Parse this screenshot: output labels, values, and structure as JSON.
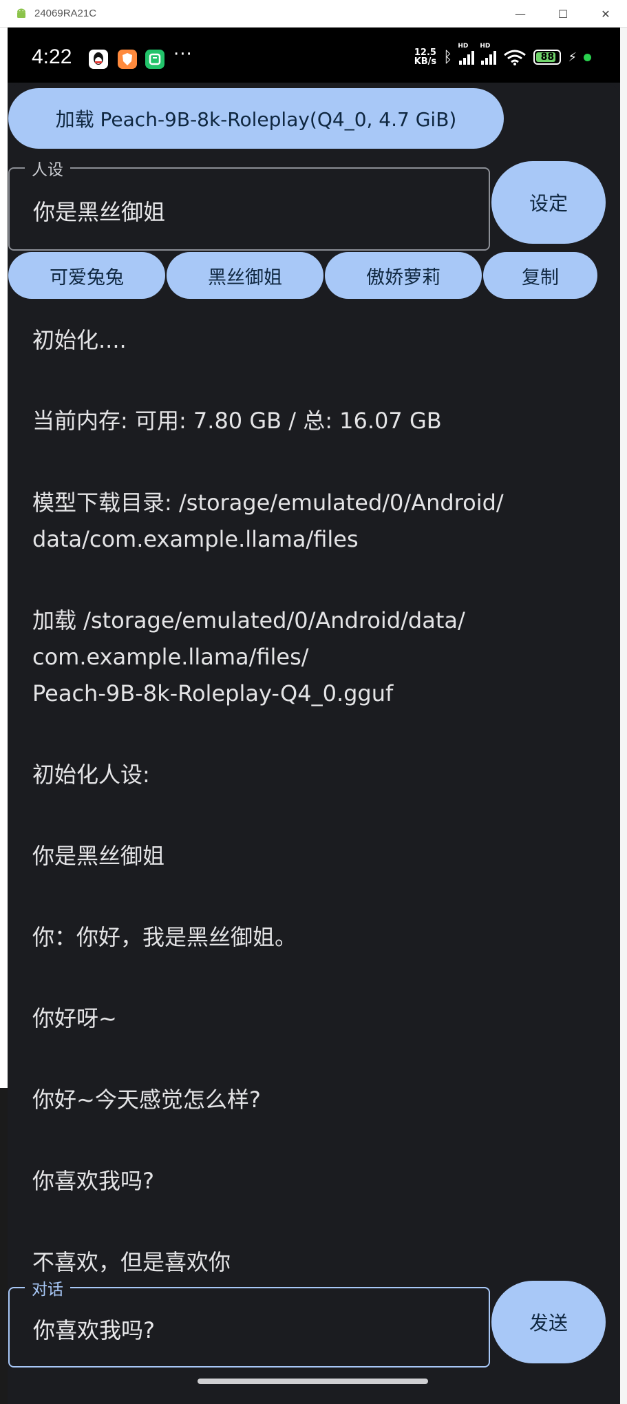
{
  "window": {
    "title": "24069RA21C",
    "minimize": "—",
    "maximize": "☐",
    "close": "✕"
  },
  "status_bar": {
    "time": "4:22",
    "more": "···",
    "net_speed_value": "12.5",
    "net_speed_unit": "KB/s",
    "hd1": "HD",
    "hd2": "HD",
    "battery": "88",
    "icons": [
      "qq-icon",
      "orange-app-icon",
      "green-app-icon",
      "bluetooth-icon",
      "signal-icon",
      "wifi-icon",
      "battery-icon",
      "charging-icon"
    ]
  },
  "toolbar": {
    "load_label": "加载 Peach-9B-8k-Roleplay(Q4_0, 4.7 GiB)",
    "set_label": "设定",
    "send_label": "发送"
  },
  "persona": {
    "legend": "人设",
    "value": "你是黑丝御姐"
  },
  "presets": [
    "可爱兔兔",
    "黑丝御姐",
    "傲娇萝莉",
    "复制"
  ],
  "log": [
    "初始化....",
    "当前内存: 可用: 7.80 GB / 总: 16.07 GB",
    "模型下载目录: /storage/emulated/0/Android/",
    "data/com.example.llama/files",
    "加载 /storage/emulated/0/Android/data/",
    "com.example.llama/files/",
    "Peach-9B-8k-Roleplay-Q4_0.gguf",
    "初始化人设:",
    "你是黑丝御姐",
    "你：你好，我是黑丝御姐。",
    "你好呀~",
    "你好~今天感觉怎么样?",
    "你喜欢我吗?",
    "不喜欢，但是喜欢你"
  ],
  "dialog": {
    "legend": "对话",
    "value": "你喜欢我吗?"
  },
  "colors": {
    "accent": "#a8c8f7",
    "background": "#1b1c20",
    "text": "#e4e4e6"
  }
}
